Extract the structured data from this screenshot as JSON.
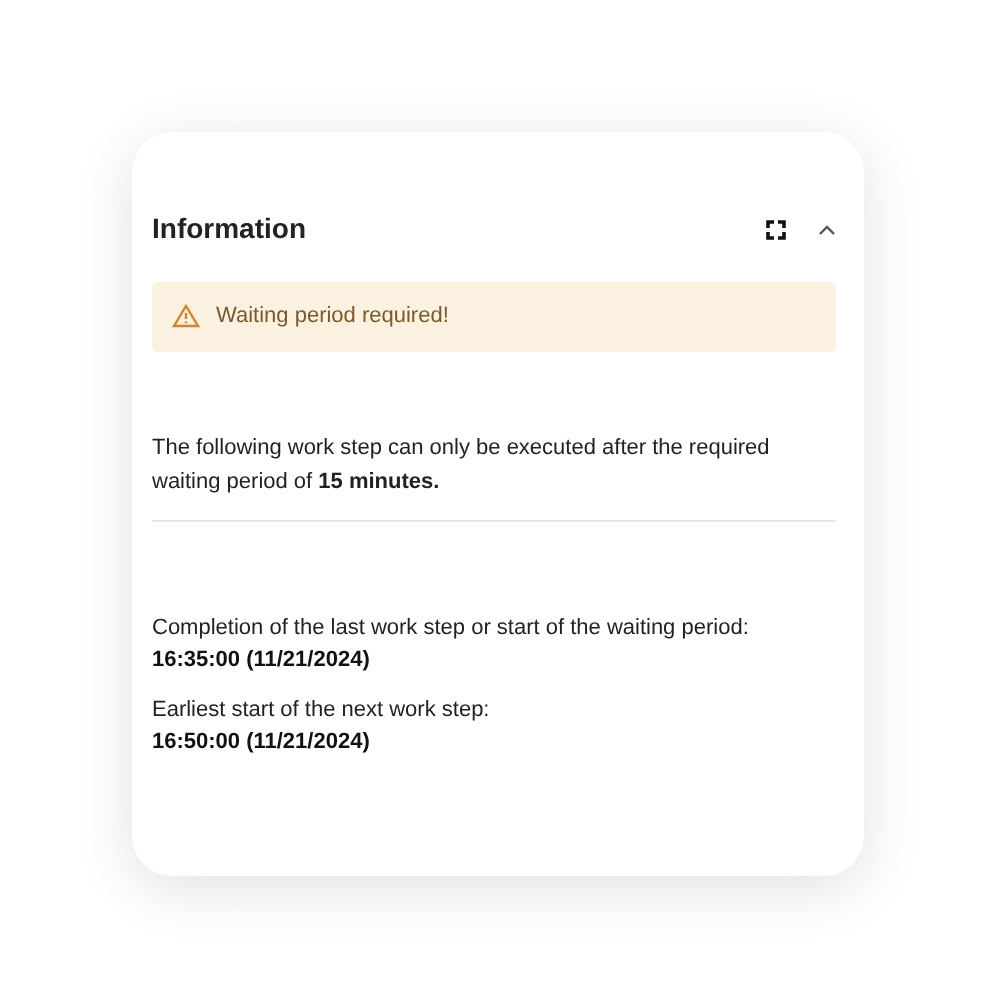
{
  "panel": {
    "title": "Information"
  },
  "alert": {
    "kind": "warning",
    "text": "Waiting period required!"
  },
  "message": "The following work step can only be executed after the required waiting period of **15 minutes.**",
  "details": [
    {
      "label": "Completion of the last work step or start of the waiting period:",
      "value": "16:35:00 (11/21/2024)"
    },
    {
      "label": "Earliest start of the next work step:",
      "value": "16:50:00 (11/21/2024)"
    }
  ]
}
